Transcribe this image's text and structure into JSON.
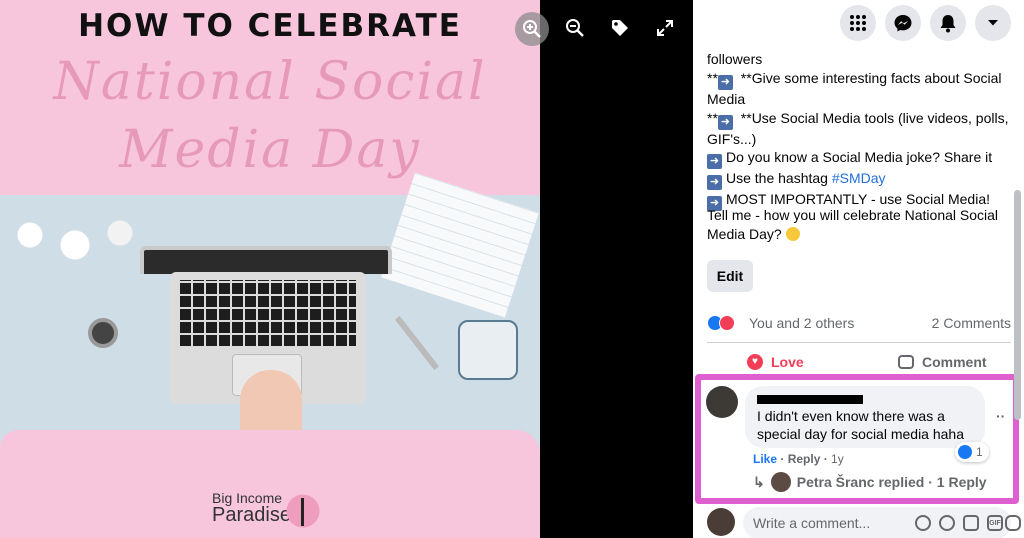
{
  "image": {
    "headline": "HOW TO CELEBRATE",
    "script_line1": "National Social",
    "script_line2": "Media Day",
    "brand_top": "Big Income",
    "brand_bottom": "Paradise"
  },
  "viewer_toolbar": {
    "icons": [
      "zoom-in-icon",
      "zoom-out-icon",
      "tag-icon",
      "fullscreen-icon"
    ]
  },
  "topbar": {
    "icons": [
      "menu-grid-icon",
      "messenger-icon",
      "notifications-icon",
      "account-chevron-icon"
    ]
  },
  "post": {
    "lines": [
      "followers",
      "**➡️ **Give some interesting facts about Social",
      "Media",
      "**➡️ **Use Social Media tools (live videos, polls,",
      "GIF's...)",
      "➡️ Do you know a Social Media joke? Share it",
      "➡️ Use the hashtag #SMDay",
      "➡️ MOST IMPORTANTLY - use Social Media!"
    ],
    "line1_prefix": "**",
    "line1_text": " **Give some interesting facts about Social",
    "line2_text": "Media",
    "line3_text": " **Use Social Media tools (live videos, polls,",
    "line4_text": "GIF's...)",
    "line5_text": "Do you know a Social Media joke? Share it",
    "line6_text": "Use the hashtag ",
    "hashtag": "#SMDay",
    "line7_text": "MOST IMPORTANTLY - use Social Media!",
    "first_line": "followers",
    "question": "Tell me - how you will celebrate National Social Media Day?",
    "edit_label": "Edit"
  },
  "reactions": {
    "summary": "You and 2 others",
    "comments": "2 Comments"
  },
  "actions": {
    "love_label": "Love",
    "comment_label": "Comment"
  },
  "comment": {
    "text": "I didn't even know there was a special day for social media haha",
    "like_label": "Like",
    "separator": " · ",
    "reply_label": "Reply",
    "age": "1y",
    "reaction_count": "1",
    "menu": "··",
    "replied_text": "Petra Šranc replied · 1 Reply"
  },
  "composer": {
    "placeholder": "Write a comment...",
    "gif_label": "GIF"
  },
  "colors": {
    "accent": "#1877f2",
    "love": "#f33e58",
    "highlight": "#e05fd0",
    "hashtag": "#216fdb"
  }
}
